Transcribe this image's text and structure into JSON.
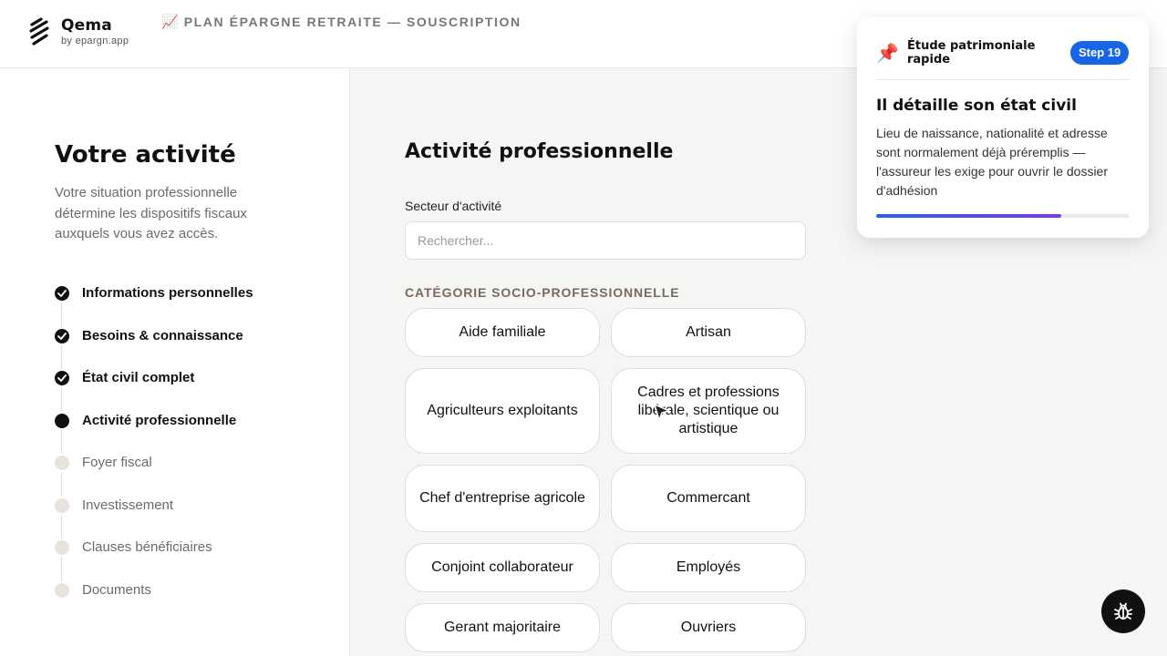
{
  "header": {
    "brand": "Qema",
    "brand_sub": "by epargn.app",
    "title_emoji": "📈",
    "title": "PLAN ÉPARGNE RETRAITE — SOUSCRIPTION"
  },
  "sidebar": {
    "title": "Votre activité",
    "description": "Votre situation professionnelle détermine les dispositifs fiscaux auxquels vous avez accès.",
    "steps": [
      {
        "label": "Informations personnelles",
        "status": "done"
      },
      {
        "label": "Besoins & connaissance",
        "status": "done"
      },
      {
        "label": "État civil complet",
        "status": "done"
      },
      {
        "label": "Activité professionnelle",
        "status": "current"
      },
      {
        "label": "Foyer fiscal",
        "status": "todo"
      },
      {
        "label": "Investissement",
        "status": "todo"
      },
      {
        "label": "Clauses bénéficiaires",
        "status": "todo"
      },
      {
        "label": "Documents",
        "status": "todo"
      }
    ]
  },
  "main": {
    "title": "Activité professionnelle",
    "sector_label": "Secteur d'activité",
    "sector_placeholder": "Rechercher...",
    "csp_label": "CATÉGORIE SOCIO-PROFESSIONNELLE",
    "options": [
      "Aide familiale",
      "Artisan",
      "Agriculteurs exploitants",
      "Cadres et professions libérale, scientique ou artistique",
      "Chef d'entreprise agricole",
      "Commercant",
      "Conjoint collaborateur",
      "Employés",
      "Gerant majoritaire",
      "Ouvriers"
    ]
  },
  "tour": {
    "pin_emoji": "📌",
    "header": "Étude patrimoniale rapide",
    "step_badge": "Step 19",
    "title": "Il détaille son état civil",
    "body": "Lieu de naissance, nationalité et adresse sont normalement déjà préremplis — l'assureur les exige pour ouvrir le dossier d'adhésion",
    "progress_fraction": 0.73
  },
  "colors": {
    "accent_blue": "#1565e6",
    "progress_start": "#2563eb",
    "progress_end": "#7c3aed",
    "step_todo": "#e8e3db"
  },
  "icons": {
    "logo": "qema-logo-icon",
    "bug": "bug-icon",
    "check": "check-icon"
  }
}
